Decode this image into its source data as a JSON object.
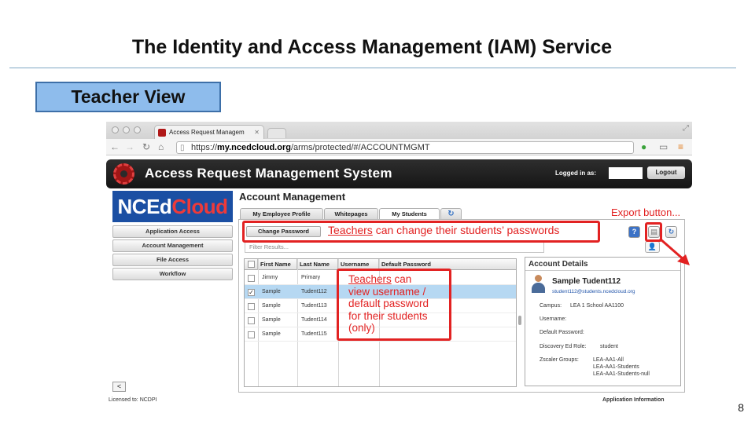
{
  "slide": {
    "title": "The Identity and Access Management (IAM) Service",
    "view_label": "Teacher View",
    "page_number": "8"
  },
  "browser": {
    "tab_title": "Access Request Managem",
    "url_scheme": "https://",
    "url_host": "my.ncedcloud.org",
    "url_path": "/arms/protected/#/ACCOUNTMGMT"
  },
  "app": {
    "title": "Access Request Management System",
    "logged_in_label": "Logged in as:",
    "logout_label": "Logout",
    "brand_left": "NCEd",
    "brand_right": "Cloud"
  },
  "sidebar": {
    "items": [
      {
        "label": "Application Access"
      },
      {
        "label": "Account Management"
      },
      {
        "label": "File Access"
      },
      {
        "label": "Workflow"
      }
    ],
    "back_label": "<"
  },
  "footer": {
    "licensed": "Licensed to:  NCDPI",
    "app_info": "Application Information"
  },
  "main": {
    "title": "Account Management",
    "tabs": [
      {
        "label": "My Employee Profile"
      },
      {
        "label": "Whitepages"
      },
      {
        "label": "My Students"
      }
    ],
    "change_password_label": "Change Password",
    "filter_placeholder": "Filter Results..."
  },
  "grid": {
    "columns": [
      "First Name",
      "Last Name",
      "Username",
      "Default Password"
    ],
    "rows": [
      {
        "first": "Jimmy",
        "last": "Primary",
        "checked": false
      },
      {
        "first": "Sample",
        "last": "Tudent112",
        "checked": true
      },
      {
        "first": "Sample",
        "last": "Tudent113",
        "checked": false
      },
      {
        "first": "Sample",
        "last": "Tudent114",
        "checked": false
      },
      {
        "first": "Sample",
        "last": "Tudent115",
        "checked": false
      }
    ]
  },
  "details": {
    "title": "Account Details",
    "name": "Sample Tudent112",
    "email": "student112@students.ncedcloud.org",
    "campus_label": "Campus:",
    "campus_value": "LEA 1 School AA1100",
    "username_label": "Username:",
    "default_password_label": "Default Password:",
    "role_label": "Discovery Ed Role:",
    "role_value": "student",
    "zscaler_label": "Zscaler Groups:",
    "zscaler_values": [
      "LEA-AA1-All",
      "LEA-AA1-Students",
      "LEA-AA1-Students-null"
    ]
  },
  "annotations": {
    "export": "Export button...",
    "teachers_word": "Teachers",
    "change_pw_rest": " can change their students’ passwords",
    "view_line2": " can",
    "view_line3": "view username /",
    "view_line4": "default password",
    "view_line5": "for their students",
    "view_line6": "(only)",
    "color": "#e22222"
  }
}
